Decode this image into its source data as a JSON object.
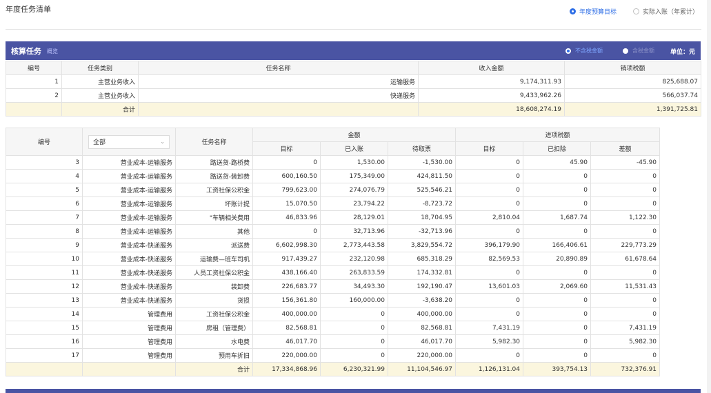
{
  "header": {
    "title": "年度任务清单",
    "mode_options": [
      {
        "label": "年度预算目标",
        "selected": true
      },
      {
        "label": "实际入账（年累计）",
        "selected": false
      }
    ]
  },
  "panel": {
    "title": "核算任务",
    "subtitle": "概览",
    "tax_options": [
      {
        "label": "不含税金额",
        "selected": true
      },
      {
        "label": "含税金额",
        "selected": false
      }
    ],
    "unit_label": "单位：元"
  },
  "income_table": {
    "headers": [
      "编号",
      "任务类别",
      "任务名称",
      "收入金额",
      "销项税额"
    ],
    "rows": [
      {
        "no": "1",
        "category": "主营业务收入",
        "name": "运输服务",
        "income": "9,174,311.93",
        "tax": "825,688.07"
      },
      {
        "no": "2",
        "category": "主营业务收入",
        "name": "快递服务",
        "income": "9,433,962.26",
        "tax": "566,037.74"
      }
    ],
    "total": {
      "label": "合计",
      "income": "18,608,274.19",
      "tax": "1,391,725.81"
    }
  },
  "cost_table": {
    "headers": {
      "no": "编号",
      "category_filter": "全部",
      "name": "任务名称",
      "amount_group": "金额",
      "tax_group": "进项税额",
      "target": "目标",
      "posted": "已入账",
      "pending": "待取票",
      "tax_target": "目标",
      "deducted": "已扣除",
      "diff": "差额"
    },
    "rows": [
      {
        "no": "3",
        "category": "营业成本-运输服务",
        "name": "路送货-路桥费",
        "target": "0",
        "posted": "1,530.00",
        "pending": "-1,530.00",
        "tax_target": "0",
        "deducted": "45.90",
        "diff": "-45.90"
      },
      {
        "no": "4",
        "category": "营业成本-运输服务",
        "name": "路送货-装卸费",
        "target": "600,160.50",
        "posted": "175,349.00",
        "pending": "424,811.50",
        "tax_target": "0",
        "deducted": "0",
        "diff": "0"
      },
      {
        "no": "5",
        "category": "营业成本-运输服务",
        "name": "工资社保公积金",
        "target": "799,623.00",
        "posted": "274,076.79",
        "pending": "525,546.21",
        "tax_target": "0",
        "deducted": "0",
        "diff": "0"
      },
      {
        "no": "6",
        "category": "营业成本-运输服务",
        "name": "坏账计提",
        "target": "15,070.50",
        "posted": "23,794.22",
        "pending": "-8,723.72",
        "tax_target": "0",
        "deducted": "0",
        "diff": "0"
      },
      {
        "no": "7",
        "category": "营业成本-运输服务",
        "name": "\"车辆相关费用",
        "target": "46,833.96",
        "posted": "28,129.01",
        "pending": "18,704.95",
        "tax_target": "2,810.04",
        "deducted": "1,687.74",
        "diff": "1,122.30"
      },
      {
        "no": "8",
        "category": "营业成本-运输服务",
        "name": "其他",
        "target": "0",
        "posted": "32,713.96",
        "pending": "-32,713.96",
        "tax_target": "0",
        "deducted": "0",
        "diff": "0"
      },
      {
        "no": "9",
        "category": "营业成本-快递服务",
        "name": "派送费",
        "target": "6,602,998.30",
        "posted": "2,773,443.58",
        "pending": "3,829,554.72",
        "tax_target": "396,179.90",
        "deducted": "166,406.61",
        "diff": "229,773.29"
      },
      {
        "no": "10",
        "category": "营业成本-快递服务",
        "name": "运输费—班车司机",
        "target": "917,439.27",
        "posted": "232,120.98",
        "pending": "685,318.29",
        "tax_target": "82,569.53",
        "deducted": "20,890.89",
        "diff": "61,678.64"
      },
      {
        "no": "11",
        "category": "营业成本-快递服务",
        "name": "人员工资社保公积金",
        "target": "438,166.40",
        "posted": "263,833.59",
        "pending": "174,332.81",
        "tax_target": "0",
        "deducted": "0",
        "diff": "0"
      },
      {
        "no": "12",
        "category": "营业成本-快递服务",
        "name": "装卸费",
        "target": "226,683.77",
        "posted": "34,493.30",
        "pending": "192,190.47",
        "tax_target": "13,601.03",
        "deducted": "2,069.60",
        "diff": "11,531.43"
      },
      {
        "no": "13",
        "category": "营业成本-快递服务",
        "name": "货损",
        "target": "156,361.80",
        "posted": "160,000.00",
        "pending": "-3,638.20",
        "tax_target": "0",
        "deducted": "0",
        "diff": "0"
      },
      {
        "no": "14",
        "category": "管理费用",
        "name": "工资社保公积金",
        "target": "400,000.00",
        "posted": "0",
        "pending": "400,000.00",
        "tax_target": "0",
        "deducted": "0",
        "diff": "0"
      },
      {
        "no": "15",
        "category": "管理费用",
        "name": "房租（管理费）",
        "target": "82,568.81",
        "posted": "0",
        "pending": "82,568.81",
        "tax_target": "7,431.19",
        "deducted": "0",
        "diff": "7,431.19"
      },
      {
        "no": "16",
        "category": "管理费用",
        "name": "水电费",
        "target": "46,017.70",
        "posted": "0",
        "pending": "46,017.70",
        "tax_target": "5,982.30",
        "deducted": "0",
        "diff": "5,982.30"
      },
      {
        "no": "17",
        "category": "管理费用",
        "name": "预用车折旧",
        "target": "220,000.00",
        "posted": "0",
        "pending": "220,000.00",
        "tax_target": "0",
        "deducted": "0",
        "diff": "0"
      }
    ],
    "total": {
      "label": "合计",
      "target": "17,334,868.96",
      "posted": "6,230,321.99",
      "pending": "11,104,546.97",
      "tax_target": "1,126,131.04",
      "deducted": "393,754.13",
      "diff": "732,376.91"
    }
  },
  "colors": {
    "panel_header": "#4a54a3",
    "total_row": "#fbf6de",
    "radio_selected": "#2e6ee6"
  }
}
